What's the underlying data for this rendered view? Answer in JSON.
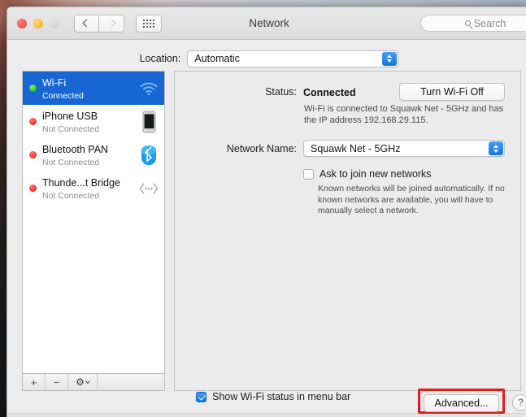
{
  "window": {
    "title": "Network",
    "traffic_lights": [
      "close",
      "minimize",
      "maximize-disabled"
    ],
    "nav": {
      "back_icon": "chevron-left-icon",
      "forward_icon": "chevron-right-icon",
      "grid_icon": "show-all-grid-icon"
    },
    "search": {
      "placeholder": "Search",
      "icon": "search-icon",
      "value": ""
    }
  },
  "location": {
    "label": "Location:",
    "value": "Automatic",
    "options": [
      "Automatic"
    ]
  },
  "sidebar": {
    "services": [
      {
        "name": "Wi-Fi",
        "state": "Connected",
        "status_color": "#27c322",
        "icon": "wifi-icon",
        "selected": true
      },
      {
        "name": "iPhone USB",
        "state": "Not Connected",
        "status_color": "#ec2f28",
        "icon": "iphone-icon",
        "selected": false
      },
      {
        "name": "Bluetooth PAN",
        "state": "Not Connected",
        "status_color": "#ec2f28",
        "icon": "bluetooth-icon",
        "selected": false
      },
      {
        "name": "Thunde...t Bridge",
        "state": "Not Connected",
        "status_color": "#ec2f28",
        "icon": "thunderbolt-bridge-icon",
        "selected": false
      }
    ],
    "footer": {
      "add_label": "+",
      "remove_label": "−",
      "gear_label": "⚙",
      "gear_icon": "gear-icon",
      "chevron_icon": "chevron-down-icon"
    }
  },
  "main": {
    "status_label": "Status:",
    "status_value": "Connected",
    "turn_wifi_off_label": "Turn Wi-Fi Off",
    "status_description": "Wi-Fi is connected to Squawk Net - 5GHz and has the IP address 192.168.29.115.",
    "network_name_label": "Network Name:",
    "network_name_value": "Squawk Net - 5GHz",
    "network_name_options": [
      "Squawk Net - 5GHz"
    ],
    "ask_to_join_label": "Ask to join new networks",
    "ask_to_join_checked": false,
    "ask_to_join_description": "Known networks will be joined automatically. If no known networks are available, you will have to manually select a network."
  },
  "bottom": {
    "show_status_label": "Show Wi-Fi status in menu bar",
    "show_status_checked": true,
    "advanced_label": "Advanced...",
    "help_label": "?",
    "highlight_color": "#e31b1b"
  }
}
